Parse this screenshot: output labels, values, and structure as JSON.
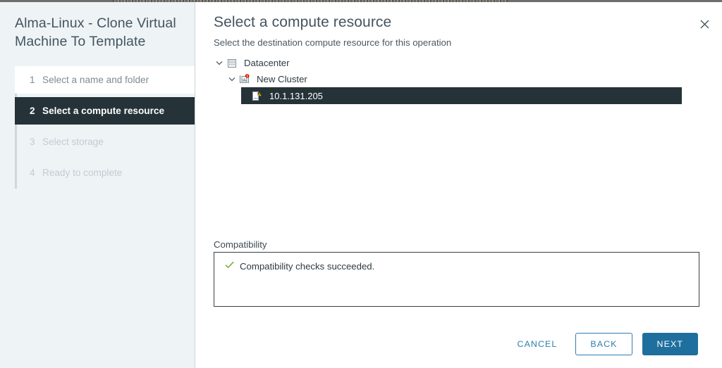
{
  "window": {
    "wizard_title": "Alma-Linux - Clone Virtual Machine To Template",
    "close_icon": "close-icon"
  },
  "sidebar": {
    "steps": [
      {
        "num": "1",
        "label": "Select a name and folder",
        "state": "done"
      },
      {
        "num": "2",
        "label": "Select a compute resource",
        "state": "active"
      },
      {
        "num": "3",
        "label": "Select storage",
        "state": "upcoming"
      },
      {
        "num": "4",
        "label": "Ready to complete",
        "state": "upcoming"
      }
    ]
  },
  "main": {
    "title": "Select a compute resource",
    "subtitle": "Select the destination compute resource for this operation",
    "tree": [
      {
        "label": "Datacenter",
        "level": 1,
        "icon": "datacenter-icon",
        "chevron": "chevron-down-icon",
        "expanded": true,
        "selected": false,
        "badge": ""
      },
      {
        "label": "New Cluster",
        "level": 2,
        "icon": "cluster-icon",
        "chevron": "chevron-down-icon",
        "expanded": true,
        "selected": false,
        "badge": "critical"
      },
      {
        "label": "10.1.131.205",
        "level": 3,
        "icon": "host-icon",
        "chevron": "",
        "expanded": false,
        "selected": true,
        "badge": "warning"
      }
    ],
    "compatibility": {
      "label": "Compatibility",
      "status_icon": "check-icon",
      "message": "Compatibility checks succeeded."
    }
  },
  "footer": {
    "cancel_label": "CANCEL",
    "back_label": "BACK",
    "next_label": "NEXT"
  },
  "colors": {
    "accent_blue": "#1f6f9e",
    "link_blue": "#2d7eaf",
    "selection_dark": "#253338",
    "progress_green": "#5aa220",
    "sidebar_bg": "#eef3f6",
    "badge_critical_red": "#e12200",
    "badge_warning_amber": "#efc006"
  }
}
